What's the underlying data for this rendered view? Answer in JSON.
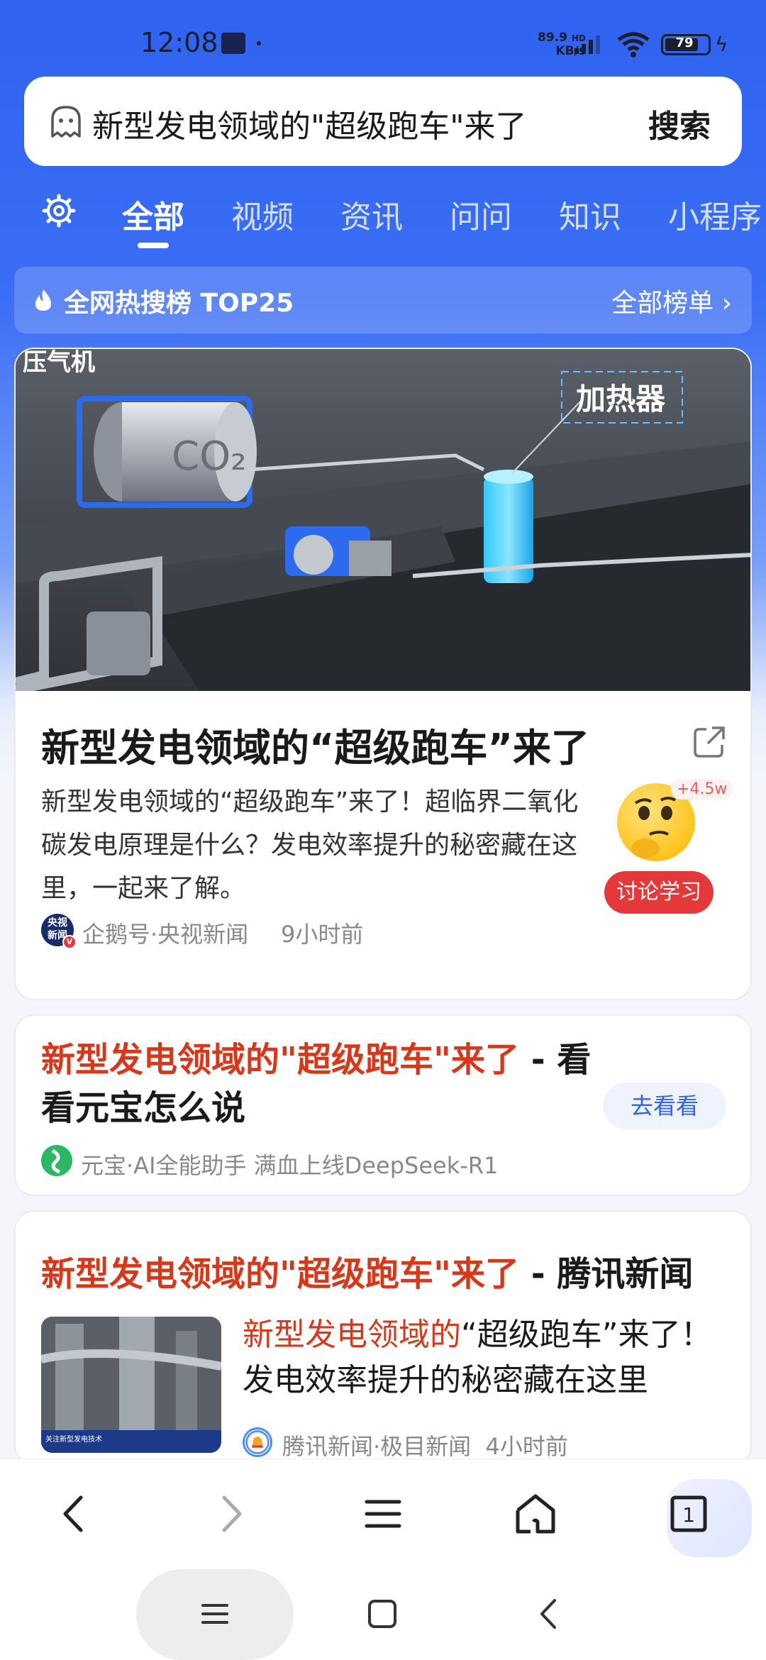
{
  "status_bar": {
    "time": "12:08",
    "net_speed_value": "89.9",
    "net_speed_unit": "KB/s",
    "network": "HD",
    "battery": "79"
  },
  "search": {
    "query": "新型发电领域的\"超级跑车\"来了",
    "button": "搜索"
  },
  "tabs": [
    {
      "label": "全部",
      "active": true
    },
    {
      "label": "视频"
    },
    {
      "label": "资讯"
    },
    {
      "label": "问问"
    },
    {
      "label": "知识"
    },
    {
      "label": "小程序"
    }
  ],
  "hot_list": {
    "title": "全网热搜榜  TOP25",
    "all_link": "全部榜单 ›"
  },
  "card1": {
    "hero_labels": {
      "top_left": "压气机",
      "heater": "加热器",
      "tank": "CO₂"
    },
    "title": "新型发电领域的“超级跑车”来了",
    "summary": "新型发电领域的“超级跑车”来了！超临界二氧化碳发电原理是什么？发电效率提升的秘密藏在这里，一起来了解。",
    "reaction_count": "+4.5w",
    "discuss_button": "讨论学习",
    "source_avatar": "央视\n新闻",
    "source": "企鹅号·央视新闻",
    "time": "9小时前"
  },
  "card2": {
    "title_highlight": "新型发电领域的\"超级跑车\"来了",
    "title_rest": " - 看看元宝怎么说",
    "go_button": "去看看",
    "meta": "元宝·AI全能助手 满血上线DeepSeek-R1"
  },
  "card3": {
    "title_highlight": "新型发电领域的\"超级跑车\"来了",
    "title_rest": " - 腾讯新闻",
    "sub_highlight": "新型发电领域的",
    "sub_rest": "“超级跑车”来了！发电效率提升的秘密藏在这里",
    "meta_source": "腾讯新闻·极目新闻",
    "meta_time": "4小时前",
    "thumb_caption": "关注新型发电技术"
  },
  "toolbar": {
    "tab_count": "1"
  },
  "colors": {
    "brand_blue": "#2f63f0",
    "highlight_red": "#d8371a",
    "discuss_red": "#e5383b"
  }
}
